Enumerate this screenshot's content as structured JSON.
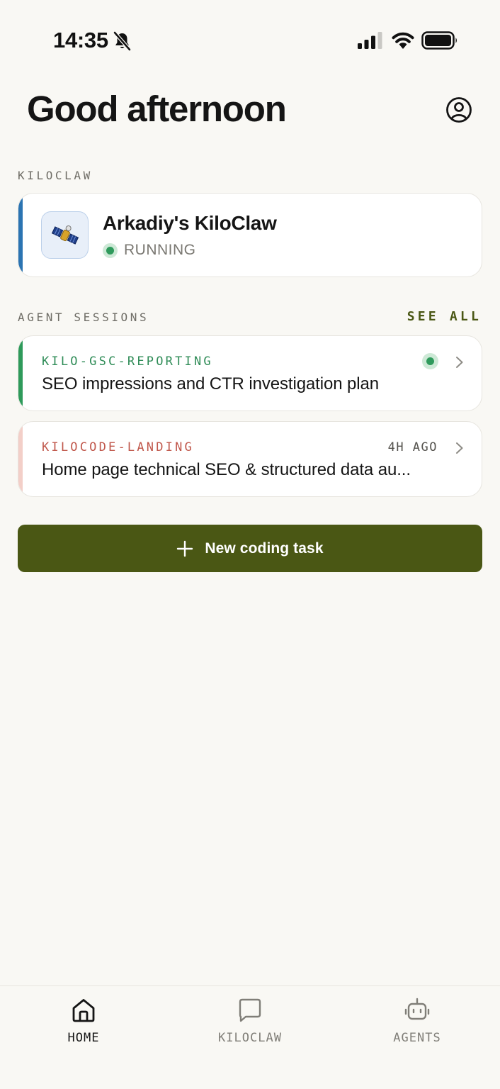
{
  "status_bar": {
    "time": "14:35"
  },
  "header": {
    "greeting": "Good afternoon"
  },
  "kiloclaw_section": {
    "label": "KILOCLAW",
    "instance": {
      "name": "Arkadiy's KiloClaw",
      "status": "RUNNING",
      "accent_color": "#2b74b2",
      "status_color": "#2f9a5c"
    }
  },
  "sessions_section": {
    "label": "AGENT SESSIONS",
    "see_all": "SEE ALL",
    "items": [
      {
        "repo": "KILO-GSC-REPORTING",
        "title": "SEO impressions and CTR investigation plan",
        "time": "",
        "active": true,
        "accent_color": "#2e9a5a"
      },
      {
        "repo": "KILOCODE-LANDING",
        "title": "Home page technical SEO & structured data au...",
        "time": "4H AGO",
        "active": false,
        "accent_color": "#f3cfc8"
      }
    ]
  },
  "new_task": {
    "label": "New coding task",
    "color": "#4a5714"
  },
  "tab_bar": {
    "tabs": [
      {
        "label": "HOME",
        "icon": "home-icon",
        "active": true
      },
      {
        "label": "KILOCLAW",
        "icon": "chat-bubble-icon",
        "active": false
      },
      {
        "label": "AGENTS",
        "icon": "robot-icon",
        "active": false
      }
    ]
  }
}
